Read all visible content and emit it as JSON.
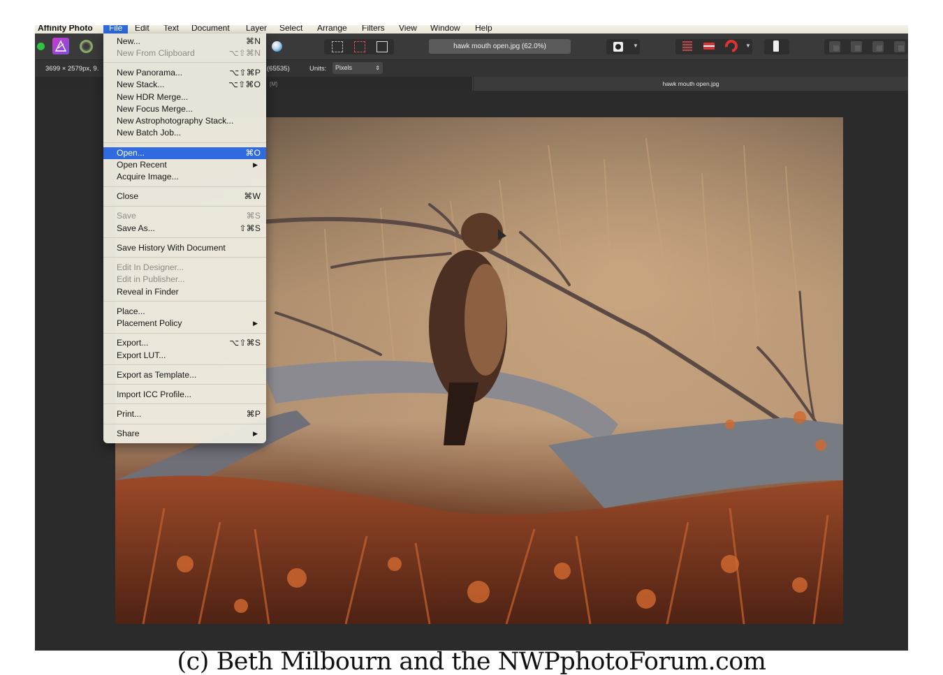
{
  "menubar": {
    "app_name": "Affinity Photo",
    "items": [
      "File",
      "Edit",
      "Text",
      "Document",
      "Layer",
      "Select",
      "Arrange",
      "Filters",
      "View",
      "Window",
      "Help"
    ]
  },
  "toolbar": {
    "document_title": "hawk mouth open.jpg (62.0%)"
  },
  "context_bar": {
    "dimensions": "3699 × 2579px, 9.",
    "color_depth": "(65535)",
    "units_label": "Units:",
    "units_value": "Pixels"
  },
  "tabs": {
    "inactive_suffix": "[M]",
    "active": "hawk mouth open.jpg"
  },
  "file_menu": {
    "items": [
      {
        "label": "New...",
        "shortcut": "⌘N"
      },
      {
        "label": "New From Clipboard",
        "shortcut": "⌥⇧⌘N",
        "disabled": true
      },
      {
        "label": "New Panorama...",
        "shortcut": "⌥⇧⌘P"
      },
      {
        "label": "New Stack...",
        "shortcut": "⌥⇧⌘O"
      },
      {
        "label": "New HDR Merge...",
        "shortcut": ""
      },
      {
        "label": "New Focus Merge...",
        "shortcut": ""
      },
      {
        "label": "New Astrophotography Stack...",
        "shortcut": ""
      },
      {
        "label": "New Batch Job...",
        "shortcut": ""
      },
      {
        "label": "Open...",
        "shortcut": "⌘O",
        "highlighted": true
      },
      {
        "label": "Open Recent",
        "shortcut": "",
        "submenu": true
      },
      {
        "label": "Acquire Image...",
        "shortcut": ""
      },
      {
        "label": "Close",
        "shortcut": "⌘W"
      },
      {
        "label": "Save",
        "shortcut": "⌘S",
        "disabled": true
      },
      {
        "label": "Save As...",
        "shortcut": "⇧⌘S"
      },
      {
        "label": "Save History With Document",
        "shortcut": ""
      },
      {
        "label": "Edit In Designer...",
        "shortcut": "",
        "disabled": true
      },
      {
        "label": "Edit in Publisher...",
        "shortcut": "",
        "disabled": true
      },
      {
        "label": "Reveal in Finder",
        "shortcut": ""
      },
      {
        "label": "Place...",
        "shortcut": ""
      },
      {
        "label": "Placement Policy",
        "shortcut": "",
        "submenu": true
      },
      {
        "label": "Export...",
        "shortcut": "⌥⇧⌘S"
      },
      {
        "label": "Export LUT...",
        "shortcut": ""
      },
      {
        "label": "Export as Template...",
        "shortcut": ""
      },
      {
        "label": "Import ICC Profile...",
        "shortcut": ""
      },
      {
        "label": "Print...",
        "shortcut": "⌘P"
      },
      {
        "label": "Share",
        "shortcut": "",
        "submenu": true
      }
    ],
    "submenu_arrow": "▶"
  },
  "caption": "(c) Beth Milbourn and the NWPphotoForum.com",
  "colors": {
    "accent": "#2f6bde",
    "toolbar_bg": "#3a3a3a",
    "canvas_bg": "#2b2b2b",
    "menu_bg": "#ece9de"
  }
}
